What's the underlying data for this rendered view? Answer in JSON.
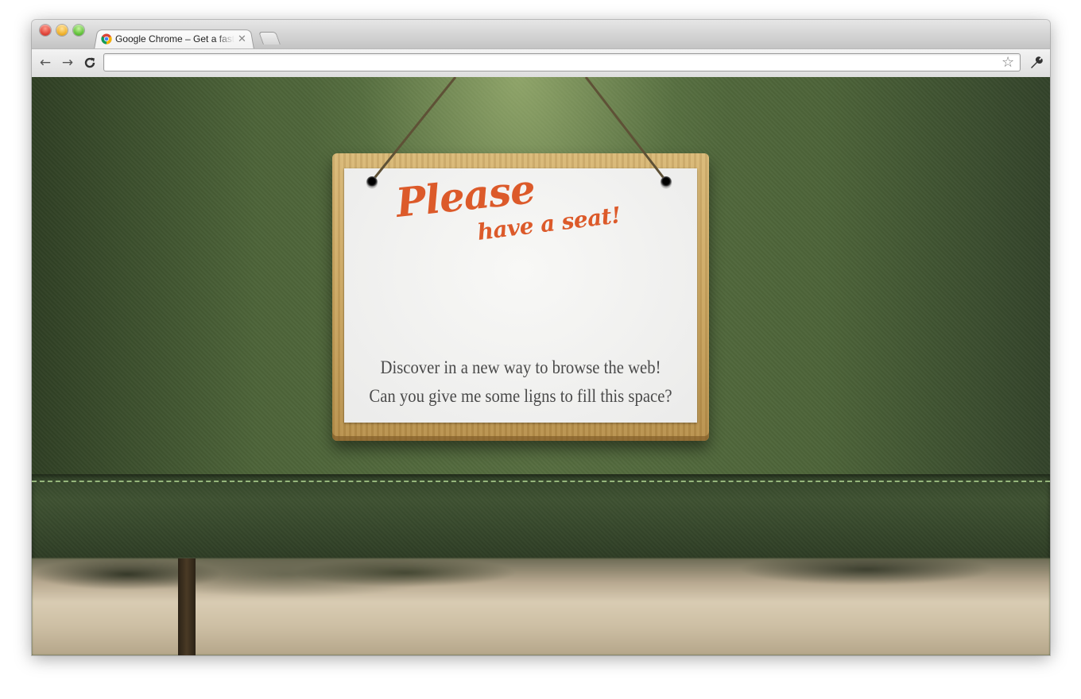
{
  "browser": {
    "tab_title": "Google Chrome – Get a fast new browser",
    "tab_close": "✕",
    "omnibox_value": "",
    "back_label": "←",
    "forward_label": "→",
    "reload_label": "C",
    "star_label": "☆"
  },
  "sign": {
    "headline_line1": "Please",
    "headline_line2": "have a seat!",
    "body_line1": "Discover in a new way to browse the web!",
    "body_line2": "Can you give me some ligns to fill this space?"
  },
  "colors": {
    "headline": "#dc5a2a",
    "fabric": "#4d6439",
    "stitch": "#a6c98a"
  }
}
